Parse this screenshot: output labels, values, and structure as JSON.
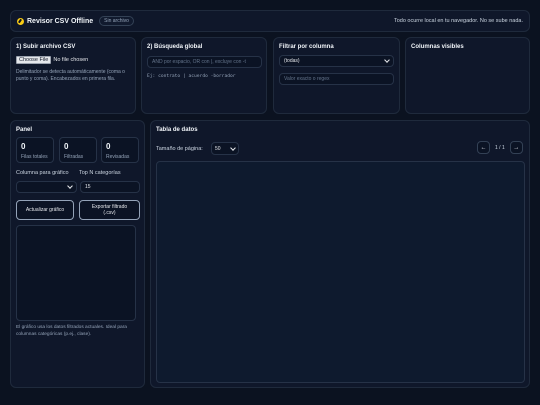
{
  "header": {
    "title": "Revisor CSV Offline",
    "badge": "Sin archivo",
    "note": "Todo ocurre local en tu navegador. No se sube nada."
  },
  "upload": {
    "title": "1) Subir archivo CSV",
    "button_label": "Choose File",
    "file_status": "No file chosen",
    "hint": "Delimitador se detecta automáticamente (coma o punto y coma). Encabezados en primera fila."
  },
  "search": {
    "title": "2) Búsqueda global",
    "placeholder": "AND por espacio, OR con |, excluye con -t",
    "example": "Ej: contrato | acuerdo -borrador"
  },
  "filter": {
    "title": "Filtrar por columna",
    "column_value": "(todas)",
    "value_placeholder": "Valor exacto o regex"
  },
  "columns": {
    "title": "Columnas visibles"
  },
  "panel": {
    "title": "Panel",
    "stats": [
      {
        "value": "0",
        "label": "Filas totales"
      },
      {
        "value": "0",
        "label": "Filtradas"
      },
      {
        "value": "0",
        "label": "Revisadas"
      }
    ],
    "chart_column_label": "Columna para gráfico",
    "topn_label": "Top N categorías",
    "chart_column_value": "",
    "topn_value": "15",
    "update_button": "Actualizar gráfico",
    "export_button": "Exportar filtrado (.csv)",
    "footnote": "El gráfico usa los datos filtrados actuales. Ideal para columnas categóricas (p.ej., clase)."
  },
  "table": {
    "title": "Tabla de datos",
    "page_size_label": "Tamaño de página:",
    "page_size_value": "50",
    "prev": "←",
    "page_info": "1 / 1",
    "next": "→"
  }
}
